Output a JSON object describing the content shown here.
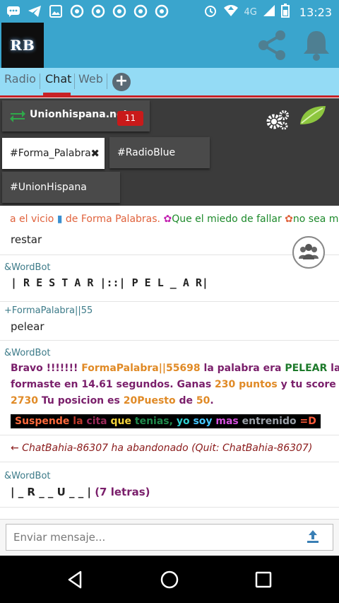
{
  "status_bar": {
    "time": "13:23",
    "network": "4G",
    "icons": [
      "message-icon",
      "telegram-icon",
      "gallery-icon",
      "chrome-icon",
      "chrome-icon",
      "chrome-icon",
      "chrome-icon",
      "chrome-icon",
      "alarm-icon",
      "wifi-icon",
      "signal-icon",
      "battery-icon"
    ]
  },
  "app": {
    "logo_text": "RB"
  },
  "tabs": [
    {
      "label": "Radio"
    },
    {
      "label": "Chat"
    },
    {
      "label": "Web"
    }
  ],
  "server": {
    "name": "Unionhispana.net",
    "count": "11"
  },
  "channels": [
    {
      "label": "#Forma_Palabra"
    },
    {
      "label": "#RadioBlue"
    },
    {
      "label": "#UnionHispana"
    }
  ],
  "topic": {
    "p1": "a el vicio ",
    "p2": "de Forma Palabras. ",
    "p3": "Que el miedo de fallar ",
    "p4": "no sea más fu"
  },
  "messages": {
    "m0_text": "restar",
    "m1_nick": "&WordBot",
    "m1_text": "| R E S T A R |::| P E L _ A R|",
    "m2_nick": "+FormaPalabra||55",
    "m2_text": "pelear",
    "m3_nick": "&WordBot",
    "m3_line1_a": "Bravo !!!!!!! ",
    "m3_line1_b": "FormaPalabra||55698",
    "m3_line1_c": " la palabra era ",
    "m3_line1_d": "PELEAR",
    "m3_line1_e": " la",
    "m3_line2_a": "formaste en 14.61 segundos. Ganas ",
    "m3_line2_b": "230 puntos",
    "m3_line2_c": " y tu score es",
    "m3_line3_a": "2730",
    "m3_line3_b": " Tu posicion es ",
    "m3_line3_c": "20Puesto",
    "m3_line3_d": " de ",
    "m3_line3_e": "50",
    "m3_line3_f": ".",
    "rainbow": [
      "Suspende ",
      "la ",
      "cita ",
      "que ",
      "tenias, ",
      "yo ",
      "soy ",
      "mas ",
      "entrenido ",
      "=D"
    ],
    "quit_text": "← ChatBahia-86307 ha abandonado (Quit: ChatBahia-86307)",
    "m4_nick": "&WordBot",
    "m4_text_a": "| _ R _ _ U _ _ | ",
    "m4_text_b": "(7 letras)"
  },
  "composer": {
    "placeholder": "Enviar mensaje..."
  },
  "colors": {
    "primary": "#3aa5cd",
    "tabs_bg": "#94dbf5",
    "accent": "#c72227",
    "panel": "#3b3b3b",
    "badge": "#c91a1a"
  }
}
